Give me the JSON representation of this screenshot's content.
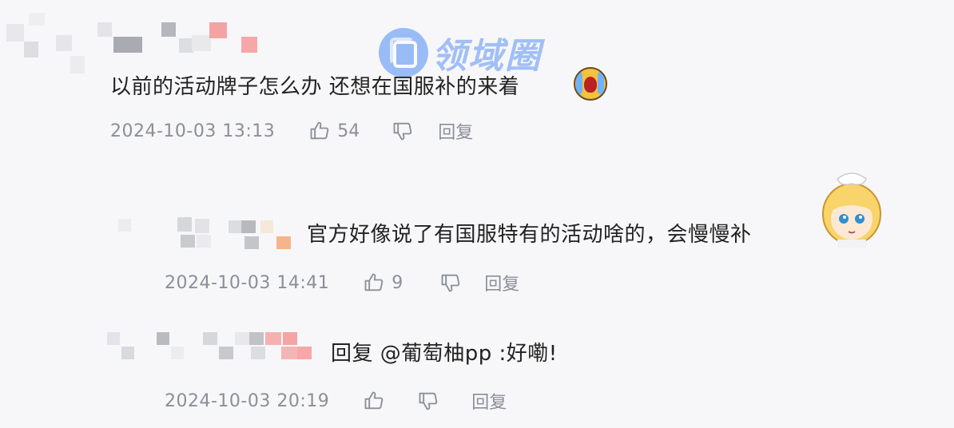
{
  "watermark": {
    "text": "领域圈"
  },
  "comments": [
    {
      "text": "以前的活动牌子怎么办 还想在国服补的来着",
      "time": "2024-10-03 13:13",
      "likes": "54",
      "reply_label": "回复"
    },
    {
      "text": "官方好像说了有国服特有的活动啥的，会慢慢补",
      "time": "2024-10-03 14:41",
      "likes": "9",
      "reply_label": "回复"
    },
    {
      "text": "回复 @葡萄柚pp :好嘞!",
      "time": "2024-10-03 20:19",
      "likes": "",
      "reply_label": "回复"
    }
  ],
  "icons": {
    "like": "thumbs-up-icon",
    "dislike": "thumbs-down-icon",
    "emoji": "crying-face-emoji",
    "avatar": "anime-girl-avatar"
  },
  "colors": {
    "meta": "#8a8f99",
    "text": "#222222",
    "background": "#f7f7f9"
  }
}
